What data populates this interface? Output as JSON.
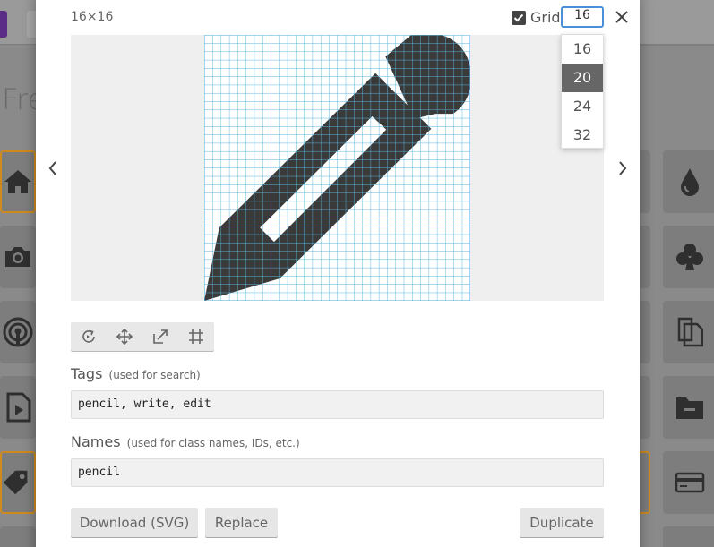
{
  "background": {
    "page_title": "Fre"
  },
  "modal": {
    "size_label": "16×16",
    "grid": {
      "label": "Grid",
      "checked": true,
      "value": "16",
      "options": [
        "16",
        "20",
        "24",
        "32"
      ],
      "highlighted": "20"
    },
    "toolbar": {
      "tools": [
        "rotate-icon",
        "move-icon",
        "resize-icon",
        "crop-icon"
      ]
    },
    "tags": {
      "label": "Tags",
      "hint": "(used for search)",
      "value": "pencil, write, edit"
    },
    "names": {
      "label": "Names",
      "hint": "(used for class names, IDs, etc.)",
      "value": "pencil"
    },
    "buttons": {
      "download": "Download (SVG)",
      "replace": "Replace",
      "duplicate": "Duplicate"
    },
    "icon_name": "pencil-icon",
    "colors": {
      "accent": "#4a90d9",
      "icon": "#3a3a3a",
      "grid_line": "#5ab4e0"
    }
  }
}
